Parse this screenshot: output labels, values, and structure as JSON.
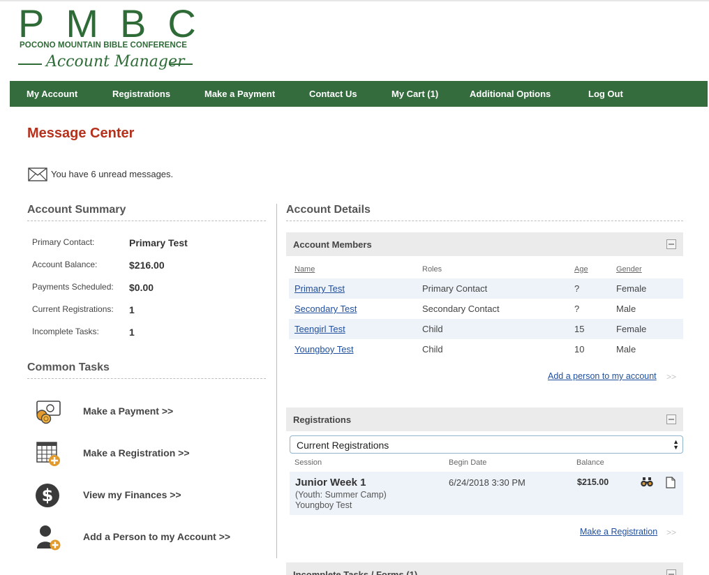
{
  "logo": {
    "letters": "PMBC",
    "subtitle": "POCONO MOUNTAIN BIBLE CONFERENCE",
    "tagline": "Account Manager"
  },
  "nav": {
    "items": [
      {
        "label": "My Account"
      },
      {
        "label": "Registrations"
      },
      {
        "label": "Make a Payment"
      },
      {
        "label": "Contact Us"
      },
      {
        "label": "My Cart (1)"
      },
      {
        "label": "Additional Options"
      },
      {
        "label": "Log Out"
      }
    ]
  },
  "message_center": {
    "title": "Message Center",
    "unread_text": "You have 6 unread messages.",
    "icon": "envelope-icon"
  },
  "account_summary": {
    "heading": "Account Summary",
    "rows": [
      {
        "label": "Primary Contact:",
        "value": "Primary Test"
      },
      {
        "label": "Account Balance:",
        "value": "$216.00"
      },
      {
        "label": "Payments Scheduled:",
        "value": "$0.00"
      },
      {
        "label": "Current Registrations:",
        "value": "1"
      },
      {
        "label": "Incomplete Tasks:",
        "value": "1"
      }
    ]
  },
  "common_tasks": {
    "heading": "Common Tasks",
    "items": [
      {
        "label": "Make a Payment  >>",
        "icon": "money-coins-icon"
      },
      {
        "label": "Make a Registration  >>",
        "icon": "calendar-add-icon"
      },
      {
        "label": "View my Finances  >>",
        "icon": "dollar-circle-icon"
      },
      {
        "label": "Add a Person to my Account  >>",
        "icon": "add-person-icon"
      }
    ]
  },
  "account_details": {
    "heading": "Account Details",
    "members": {
      "title": "Account Members",
      "columns": [
        "Name",
        "Roles",
        "Age",
        "Gender"
      ],
      "rows": [
        {
          "name": "Primary Test",
          "role": "Primary Contact",
          "age": "?",
          "gender": "Female"
        },
        {
          "name": "Secondary Test",
          "role": "Secondary Contact",
          "age": "?",
          "gender": "Male"
        },
        {
          "name": "Teengirl Test",
          "role": "Child",
          "age": "15",
          "gender": "Female"
        },
        {
          "name": "Youngboy Test",
          "role": "Child",
          "age": "10",
          "gender": "Male"
        }
      ],
      "add_link": "Add a person to my account",
      "arrow": ">>"
    },
    "registrations": {
      "title": "Registrations",
      "select_value": "Current Registrations",
      "columns": [
        "Session",
        "Begin Date",
        "Balance"
      ],
      "row": {
        "session": "Junior Week 1",
        "type": "(Youth: Summer Camp)",
        "person": "Youngboy Test",
        "begin_date": "6/24/2018 3:30 PM",
        "balance": "$215.00"
      },
      "make_link": "Make a Registration",
      "arrow": ">>"
    },
    "incomplete": {
      "title": "Incomplete Tasks / Forms (1)"
    }
  },
  "colors": {
    "brand_green": "#356c3d",
    "title_red": "#b5311b",
    "link_blue": "#1f4e9c"
  }
}
